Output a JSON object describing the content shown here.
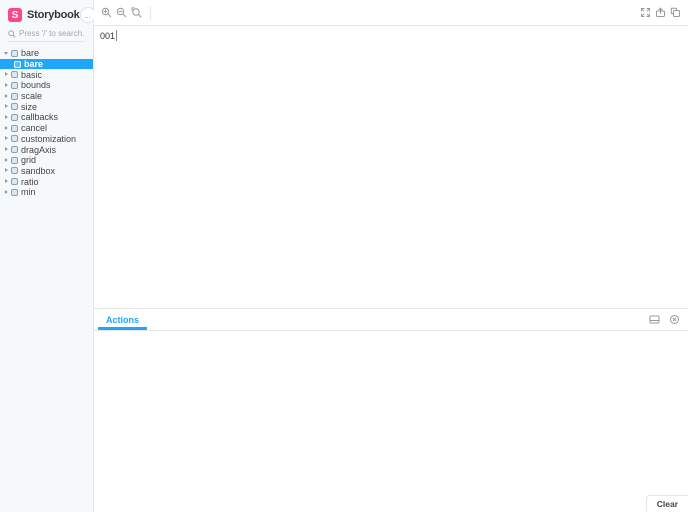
{
  "colors": {
    "brand": "#FF4785",
    "accent": "#1EA7FD",
    "sidebar_bg": "#F6F9FC",
    "border": "#E6E6E6",
    "icon_gray": "#999999"
  },
  "sidebar": {
    "brand": "Storybook",
    "logo_letter": "S",
    "menu_label": "...",
    "search": {
      "placeholder": "Press '/' to search...",
      "icon": "search-icon"
    },
    "items": [
      {
        "label": "bare",
        "type": "component",
        "state": "expanded"
      },
      {
        "label": "bare",
        "type": "story",
        "state": "selected"
      },
      {
        "label": "basic",
        "type": "component",
        "state": "collapsed"
      },
      {
        "label": "bounds",
        "type": "component",
        "state": "collapsed"
      },
      {
        "label": "scale",
        "type": "component",
        "state": "collapsed"
      },
      {
        "label": "size",
        "type": "component",
        "state": "collapsed"
      },
      {
        "label": "callbacks",
        "type": "component",
        "state": "collapsed"
      },
      {
        "label": "cancel",
        "type": "component",
        "state": "collapsed"
      },
      {
        "label": "customization",
        "type": "component",
        "state": "collapsed"
      },
      {
        "label": "dragAxis",
        "type": "component",
        "state": "collapsed"
      },
      {
        "label": "grid",
        "type": "component",
        "state": "collapsed"
      },
      {
        "label": "sandbox",
        "type": "component",
        "state": "collapsed"
      },
      {
        "label": "ratio",
        "type": "component",
        "state": "collapsed"
      },
      {
        "label": "min",
        "type": "component",
        "state": "collapsed"
      }
    ]
  },
  "toolbar": {
    "left_icons": [
      "zoom-in-icon",
      "zoom-out-icon",
      "zoom-reset-icon"
    ],
    "right_icons": [
      "fullscreen-icon",
      "open-in-new-tab-icon",
      "copy-link-icon"
    ]
  },
  "canvas": {
    "story_text": "001"
  },
  "addon_panel": {
    "tabs": [
      {
        "label": "Actions",
        "active": true
      }
    ],
    "icons": [
      "panel-position-icon",
      "close-panel-icon"
    ],
    "clear_button": "Clear"
  }
}
